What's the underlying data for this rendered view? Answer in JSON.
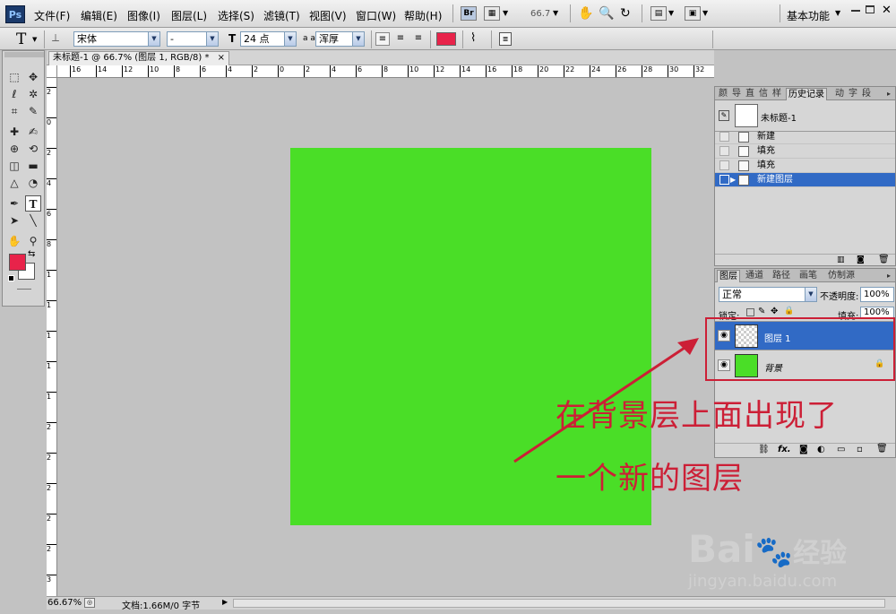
{
  "app": {
    "logo": "Ps"
  },
  "menu": [
    "文件(F)",
    "编辑(E)",
    "图像(I)",
    "图层(L)",
    "选择(S)",
    "滤镜(T)",
    "视图(V)",
    "窗口(W)",
    "帮助(H)"
  ],
  "menubar_tools": {
    "bridge": "Br",
    "zoom_value": "66.7",
    "workspace": "基本功能"
  },
  "options": {
    "tool_glyph": "T",
    "font_family": "宋体",
    "font_style": "-",
    "font_size": "24 点",
    "aa_label": "a a",
    "antialias": "浑厚",
    "color": "#e8234a"
  },
  "document": {
    "tab_title": "未标题-1 @ 66.7% (图层 1, RGB/8) *",
    "canvas_color": "#4ade27"
  },
  "ruler_h_labels": [
    "16",
    "14",
    "12",
    "10",
    "8",
    "6",
    "4",
    "2",
    "0",
    "2",
    "4",
    "6",
    "8",
    "10",
    "12",
    "14",
    "16",
    "18",
    "20",
    "22",
    "24",
    "26",
    "28",
    "30",
    "32"
  ],
  "ruler_v_labels": [
    "2",
    "0",
    "2",
    "4",
    "6",
    "8",
    "1",
    "1",
    "1",
    "1",
    "1",
    "2",
    "2",
    "2",
    "2",
    "2",
    "3"
  ],
  "status": {
    "zoom": "66.67%",
    "doc_size": "文档:1.66M/0 字节"
  },
  "history_panel": {
    "tabs": [
      "颜",
      "导",
      "直",
      "信",
      "样",
      "历史记录",
      "动",
      "字",
      "段"
    ],
    "snapshot_label": "未标题-1",
    "items": [
      "新建",
      "填充",
      "填充",
      "新建图层"
    ]
  },
  "layers_panel": {
    "tabs": [
      "图层",
      "通道",
      "路径",
      "画笔",
      "仿制源"
    ],
    "blend_mode": "正常",
    "opacity_label": "不透明度:",
    "opacity_value": "100%",
    "lock_label": "锁定:",
    "fill_label": "填充:",
    "fill_value": "100%",
    "layers": [
      {
        "name": "图层 1"
      },
      {
        "name": "背景"
      }
    ],
    "footer_icons": [
      "link-icon",
      "fx-icon",
      "mask-icon",
      "adjustment-icon",
      "group-icon",
      "new-layer-icon",
      "trash-icon"
    ]
  },
  "annotation": {
    "line1": "在背景层上面出现了",
    "line2": "一个新的图层",
    "color": "#cc1f36"
  },
  "watermark": {
    "brand": "Bai",
    "brand_cn": "经验",
    "url": "jingyan.baidu.com"
  },
  "colors": {
    "foreground": "#e8234a",
    "background": "#ffffff",
    "highlight": "#316ac5"
  }
}
